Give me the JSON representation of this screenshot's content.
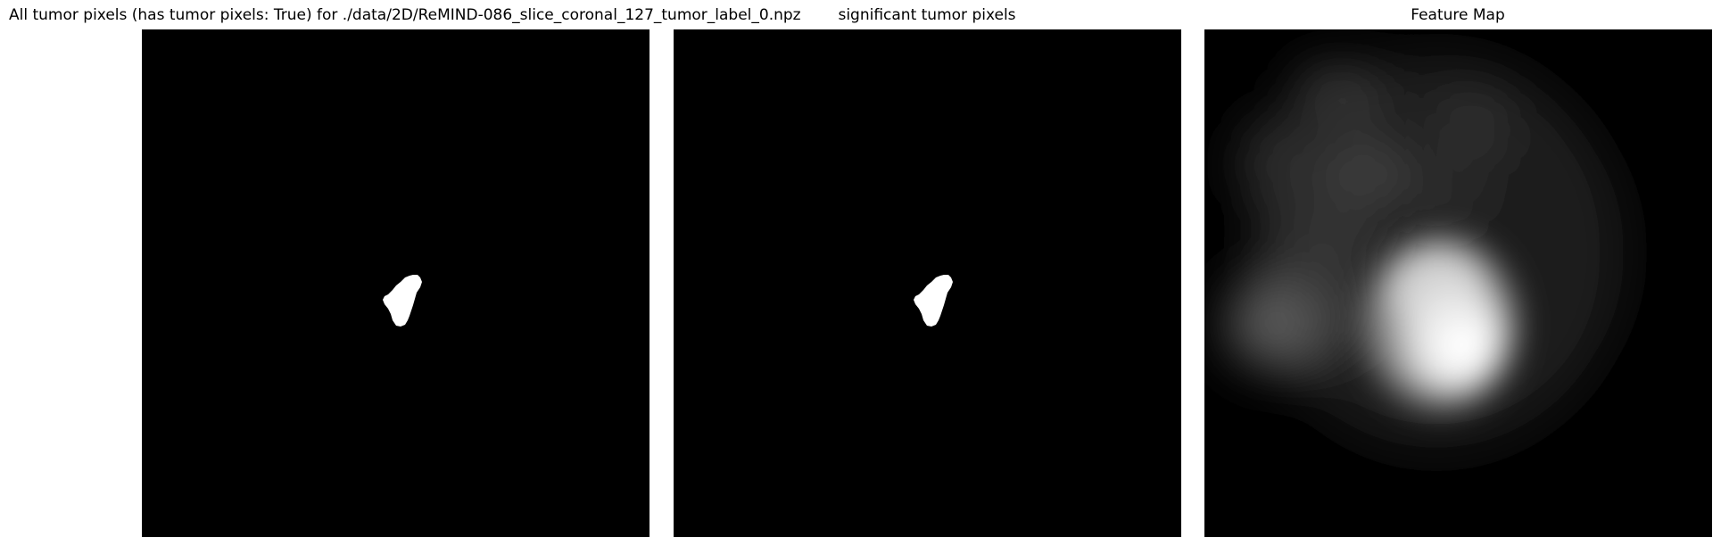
{
  "titles": {
    "all_tumor": "All tumor pixels (has tumor pixels: True) for ./data/2D/ReMIND-086_slice_coronal_127_tumor_label_0.npz",
    "significant": "significant tumor pixels",
    "feature_map": "Feature Map"
  },
  "colors": {
    "background": "#000000",
    "mask": "#ffffff"
  }
}
